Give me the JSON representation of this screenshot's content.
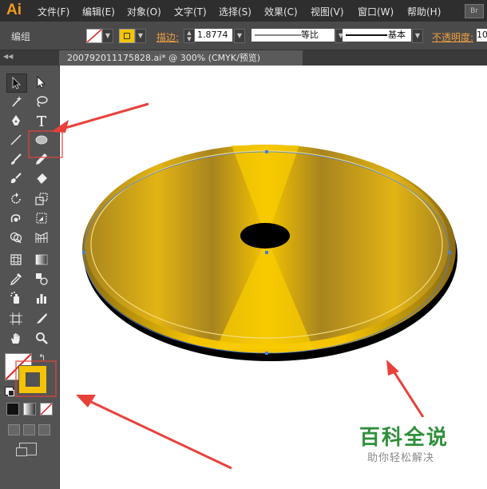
{
  "app": {
    "logo": "Ai",
    "br_button": "Br"
  },
  "menu": [
    "文件(F)",
    "编辑(E)",
    "对象(O)",
    "文字(T)",
    "选择(S)",
    "效果(C)",
    "视图(V)",
    "窗口(W)",
    "帮助(H)"
  ],
  "control_bar": {
    "selection_name": "编组",
    "fill_color": "#ffffff",
    "stroke_color": "#f5c400",
    "stroke_label": "描边:",
    "stroke_weight": "1.8774",
    "profile_label": "等比",
    "brush_label": "基本",
    "opacity_label": "不透明度:",
    "opacity_value": "10"
  },
  "document_tab": {
    "title": "200792011175828.ai* @ 300% (CMYK/预览)"
  },
  "toolbar": {
    "fill_color": "#ffffff",
    "stroke_color": "#f5c400",
    "tools": [
      "selection-tool",
      "direct-selection-tool",
      "magic-wand-tool",
      "lasso-tool",
      "pen-tool",
      "type-tool",
      "line-tool",
      "ellipse-tool",
      "paintbrush-tool",
      "pencil-tool",
      "blob-brush-tool",
      "eraser-tool",
      "rotate-tool",
      "scale-tool",
      "warp-tool",
      "free-transform-tool",
      "shape-builder-tool",
      "perspective-grid-tool",
      "mesh-tool",
      "gradient-tool",
      "eyedropper-tool",
      "blend-tool",
      "symbol-sprayer-tool",
      "column-graph-tool",
      "artboard-tool",
      "slice-tool",
      "hand-tool",
      "zoom-tool"
    ]
  },
  "watermark": {
    "title": "百科全说",
    "subtitle": "助你轻松解决",
    "title_color": "#2f8f3a"
  },
  "colors": {
    "gold": "#f5c400",
    "dark_gold": "#a8841f",
    "arrow": "#e8413a",
    "selection": "#4a7fd6"
  }
}
